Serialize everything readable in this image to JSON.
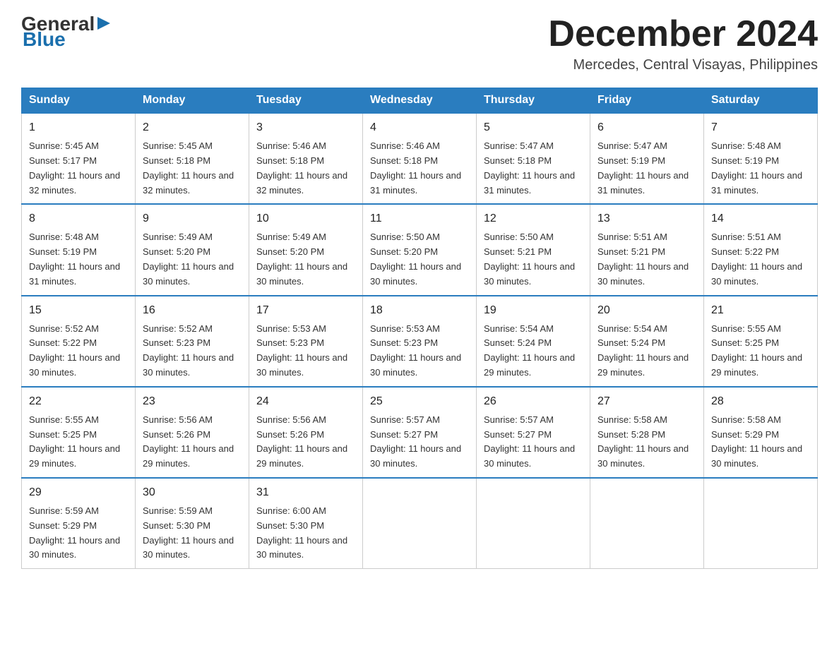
{
  "logo": {
    "general": "General",
    "blue": "Blue",
    "arrow": "▶"
  },
  "title": {
    "month_year": "December 2024",
    "location": "Mercedes, Central Visayas, Philippines"
  },
  "days_of_week": [
    "Sunday",
    "Monday",
    "Tuesday",
    "Wednesday",
    "Thursday",
    "Friday",
    "Saturday"
  ],
  "weeks": [
    [
      {
        "day": "1",
        "sunrise": "5:45 AM",
        "sunset": "5:17 PM",
        "daylight": "11 hours and 32 minutes."
      },
      {
        "day": "2",
        "sunrise": "5:45 AM",
        "sunset": "5:18 PM",
        "daylight": "11 hours and 32 minutes."
      },
      {
        "day": "3",
        "sunrise": "5:46 AM",
        "sunset": "5:18 PM",
        "daylight": "11 hours and 32 minutes."
      },
      {
        "day": "4",
        "sunrise": "5:46 AM",
        "sunset": "5:18 PM",
        "daylight": "11 hours and 31 minutes."
      },
      {
        "day": "5",
        "sunrise": "5:47 AM",
        "sunset": "5:18 PM",
        "daylight": "11 hours and 31 minutes."
      },
      {
        "day": "6",
        "sunrise": "5:47 AM",
        "sunset": "5:19 PM",
        "daylight": "11 hours and 31 minutes."
      },
      {
        "day": "7",
        "sunrise": "5:48 AM",
        "sunset": "5:19 PM",
        "daylight": "11 hours and 31 minutes."
      }
    ],
    [
      {
        "day": "8",
        "sunrise": "5:48 AM",
        "sunset": "5:19 PM",
        "daylight": "11 hours and 31 minutes."
      },
      {
        "day": "9",
        "sunrise": "5:49 AM",
        "sunset": "5:20 PM",
        "daylight": "11 hours and 30 minutes."
      },
      {
        "day": "10",
        "sunrise": "5:49 AM",
        "sunset": "5:20 PM",
        "daylight": "11 hours and 30 minutes."
      },
      {
        "day": "11",
        "sunrise": "5:50 AM",
        "sunset": "5:20 PM",
        "daylight": "11 hours and 30 minutes."
      },
      {
        "day": "12",
        "sunrise": "5:50 AM",
        "sunset": "5:21 PM",
        "daylight": "11 hours and 30 minutes."
      },
      {
        "day": "13",
        "sunrise": "5:51 AM",
        "sunset": "5:21 PM",
        "daylight": "11 hours and 30 minutes."
      },
      {
        "day": "14",
        "sunrise": "5:51 AM",
        "sunset": "5:22 PM",
        "daylight": "11 hours and 30 minutes."
      }
    ],
    [
      {
        "day": "15",
        "sunrise": "5:52 AM",
        "sunset": "5:22 PM",
        "daylight": "11 hours and 30 minutes."
      },
      {
        "day": "16",
        "sunrise": "5:52 AM",
        "sunset": "5:23 PM",
        "daylight": "11 hours and 30 minutes."
      },
      {
        "day": "17",
        "sunrise": "5:53 AM",
        "sunset": "5:23 PM",
        "daylight": "11 hours and 30 minutes."
      },
      {
        "day": "18",
        "sunrise": "5:53 AM",
        "sunset": "5:23 PM",
        "daylight": "11 hours and 30 minutes."
      },
      {
        "day": "19",
        "sunrise": "5:54 AM",
        "sunset": "5:24 PM",
        "daylight": "11 hours and 29 minutes."
      },
      {
        "day": "20",
        "sunrise": "5:54 AM",
        "sunset": "5:24 PM",
        "daylight": "11 hours and 29 minutes."
      },
      {
        "day": "21",
        "sunrise": "5:55 AM",
        "sunset": "5:25 PM",
        "daylight": "11 hours and 29 minutes."
      }
    ],
    [
      {
        "day": "22",
        "sunrise": "5:55 AM",
        "sunset": "5:25 PM",
        "daylight": "11 hours and 29 minutes."
      },
      {
        "day": "23",
        "sunrise": "5:56 AM",
        "sunset": "5:26 PM",
        "daylight": "11 hours and 29 minutes."
      },
      {
        "day": "24",
        "sunrise": "5:56 AM",
        "sunset": "5:26 PM",
        "daylight": "11 hours and 29 minutes."
      },
      {
        "day": "25",
        "sunrise": "5:57 AM",
        "sunset": "5:27 PM",
        "daylight": "11 hours and 30 minutes."
      },
      {
        "day": "26",
        "sunrise": "5:57 AM",
        "sunset": "5:27 PM",
        "daylight": "11 hours and 30 minutes."
      },
      {
        "day": "27",
        "sunrise": "5:58 AM",
        "sunset": "5:28 PM",
        "daylight": "11 hours and 30 minutes."
      },
      {
        "day": "28",
        "sunrise": "5:58 AM",
        "sunset": "5:29 PM",
        "daylight": "11 hours and 30 minutes."
      }
    ],
    [
      {
        "day": "29",
        "sunrise": "5:59 AM",
        "sunset": "5:29 PM",
        "daylight": "11 hours and 30 minutes."
      },
      {
        "day": "30",
        "sunrise": "5:59 AM",
        "sunset": "5:30 PM",
        "daylight": "11 hours and 30 minutes."
      },
      {
        "day": "31",
        "sunrise": "6:00 AM",
        "sunset": "5:30 PM",
        "daylight": "11 hours and 30 minutes."
      },
      null,
      null,
      null,
      null
    ]
  ]
}
